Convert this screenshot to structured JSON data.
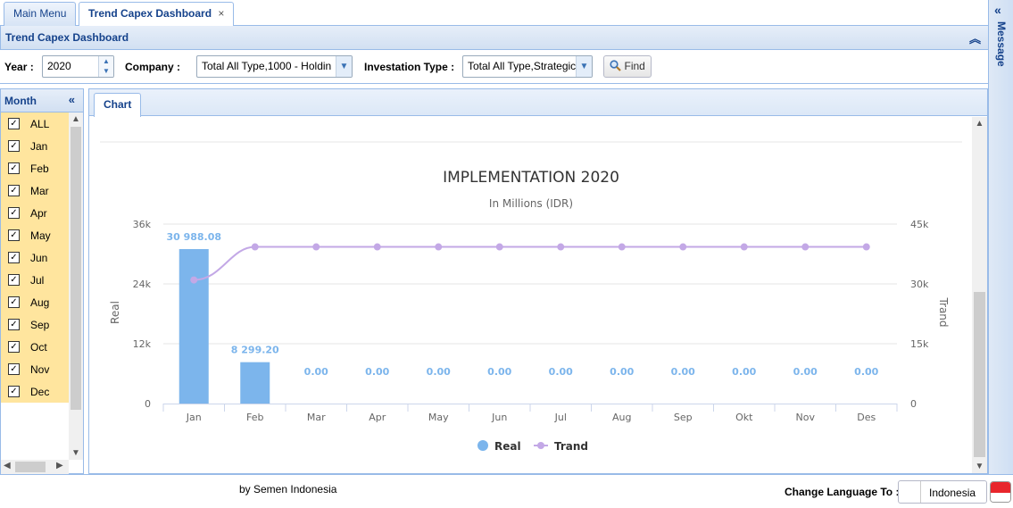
{
  "tabs": [
    {
      "label": "Main Menu",
      "active": false
    },
    {
      "label": "Trend Capex Dashboard",
      "active": true,
      "close": "×"
    }
  ],
  "message_panel": {
    "label": "Message",
    "icon": "double-chevron-left-icon"
  },
  "panel": {
    "title": "Trend Capex Dashboard",
    "collapse_icon": "double-chevron-up-icon"
  },
  "filters": {
    "year_label": "Year :",
    "year_value": "2020",
    "company_label": "Company :",
    "company_value": "Total All Type,1000 - Holdin",
    "investation_label": "Investation Type :",
    "investation_value": "Total All Type,Strategic",
    "find_label": "Find",
    "find_icon": "magnifier-icon"
  },
  "months_panel": {
    "title": "Month",
    "items": [
      {
        "label": "ALL",
        "checked": true
      },
      {
        "label": "Jan",
        "checked": true
      },
      {
        "label": "Feb",
        "checked": true
      },
      {
        "label": "Mar",
        "checked": true
      },
      {
        "label": "Apr",
        "checked": true
      },
      {
        "label": "May",
        "checked": true
      },
      {
        "label": "Jun",
        "checked": true
      },
      {
        "label": "Jul",
        "checked": true
      },
      {
        "label": "Aug",
        "checked": true
      },
      {
        "label": "Sep",
        "checked": true
      },
      {
        "label": "Oct",
        "checked": true
      },
      {
        "label": "Nov",
        "checked": true
      },
      {
        "label": "Dec",
        "checked": true
      }
    ]
  },
  "chart_tab": {
    "label": "Chart"
  },
  "chart_data": {
    "type": "bar",
    "title": "IMPLEMENTATION 2020",
    "subtitle": "In Millions (IDR)",
    "categories": [
      "Jan",
      "Feb",
      "Mar",
      "Apr",
      "May",
      "Jun",
      "Jul",
      "Aug",
      "Sep",
      "Okt",
      "Nov",
      "Des"
    ],
    "ylabel": "Real",
    "y2label": "Trand",
    "ylim": [
      0,
      36000
    ],
    "y2lim": [
      0,
      45000
    ],
    "yticks": [
      "0",
      "12k",
      "24k",
      "36k"
    ],
    "y2ticks": [
      "0",
      "15k",
      "30k",
      "45k"
    ],
    "series": [
      {
        "name": "Real",
        "type": "bar",
        "axis": "left",
        "color": "#7cb5ec",
        "values": [
          30988.08,
          8299.2,
          0,
          0,
          0,
          0,
          0,
          0,
          0,
          0,
          0,
          0
        ],
        "labels": [
          "30 988.08",
          "8 299.20",
          "0.00",
          "0.00",
          "0.00",
          "0.00",
          "0.00",
          "0.00",
          "0.00",
          "0.00",
          "0.00",
          "0.00"
        ]
      },
      {
        "name": "Trand",
        "type": "line",
        "axis": "right",
        "color": "#c3a8e6",
        "values": [
          39287.28,
          39287.28,
          39287.28,
          39287.28,
          39287.28,
          39287.28,
          39287.28,
          39287.28,
          39287.28,
          39287.28,
          39287.28,
          39287.28
        ],
        "first_value": 30988.08
      }
    ],
    "legend_position": "bottom-center",
    "grid": true
  },
  "footer": {
    "byline": "by Semen Indonesia",
    "language_label": "Change Language To :",
    "language_value": "Indonesia",
    "flag_icon": "indonesia-flag-icon"
  }
}
